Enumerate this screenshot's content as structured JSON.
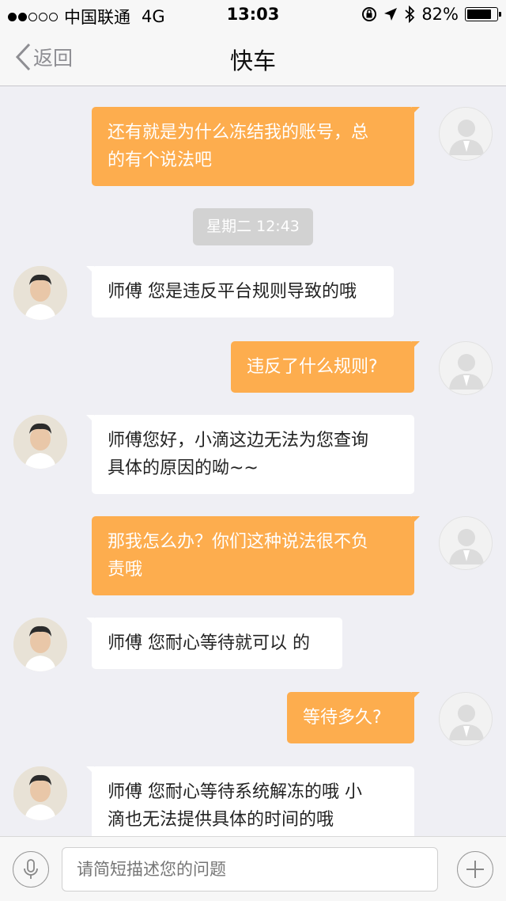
{
  "status_bar": {
    "carrier": "中国联通",
    "network": "4G",
    "time": "13:03",
    "battery": "82%",
    "battery_level": 0.82
  },
  "nav": {
    "back_label": "返回",
    "title": "快车"
  },
  "colors": {
    "outgoing_bubble": "#fdad4e",
    "incoming_bubble": "#ffffff",
    "background": "#efeff4"
  },
  "timestamp": "星期二 12:43",
  "messages": [
    {
      "side": "right",
      "lines": [
        "还有就是为什么冻结我的账号，总",
        "的有个说法吧"
      ]
    },
    {
      "side": "left",
      "lines": [
        "师傅 您是违反平台规则导致的哦"
      ]
    },
    {
      "side": "right",
      "lines": [
        "违反了什么规则?"
      ]
    },
    {
      "side": "left",
      "lines": [
        "师傅您好，小滴这边无法为您查询",
        "具体的原因的呦~~"
      ]
    },
    {
      "side": "right",
      "lines": [
        "那我怎么办？你们这种说法很不负",
        "责哦"
      ]
    },
    {
      "side": "left",
      "lines": [
        "师傅 您耐心等待就可以 的"
      ]
    },
    {
      "side": "right",
      "lines": [
        "等待多久?"
      ]
    },
    {
      "side": "left",
      "lines": [
        "师傅 您耐心等待系统解冻的哦 小",
        "滴也无法提供具体的时间的哦"
      ]
    }
  ],
  "input": {
    "placeholder": "请简短描述您的问题"
  },
  "icons": {
    "back": "chevron-left-icon",
    "mic": "microphone-icon",
    "plus": "plus-icon"
  }
}
